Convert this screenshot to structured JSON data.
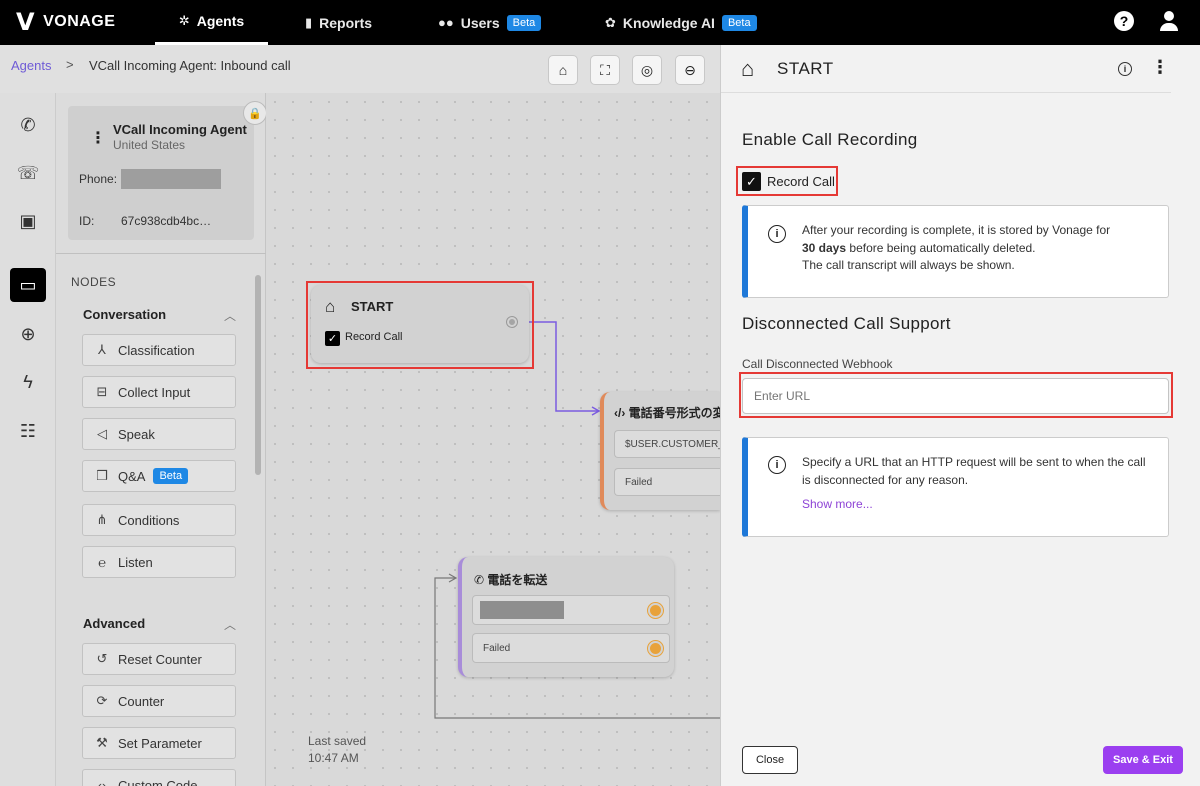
{
  "topbar": {
    "brand": "VONAGE",
    "nav": [
      {
        "label": "Agents",
        "icon": "agents-icon",
        "active": true
      },
      {
        "label": "Reports",
        "icon": "bar-chart-icon"
      },
      {
        "label": "Users",
        "icon": "users-icon",
        "badge": "Beta"
      },
      {
        "label": "Knowledge AI",
        "icon": "brain-icon",
        "badge": "Beta"
      }
    ],
    "help": "?"
  },
  "breadcrumb": {
    "root": "Agents",
    "separator": ">",
    "current": "VCall Incoming Agent: Inbound call"
  },
  "agent_card": {
    "name": "VCall Incoming Agent",
    "country": "United States",
    "phone_label": "Phone:",
    "id_label": "ID:",
    "id_value": "67c938cdb4bc…"
  },
  "nodes": {
    "title": "NODES",
    "sections": [
      {
        "title": "Conversation",
        "items": [
          {
            "label": "Classification",
            "icon": "classification-icon"
          },
          {
            "label": "Collect Input",
            "icon": "collect-input-icon"
          },
          {
            "label": "Speak",
            "icon": "speaker-icon"
          },
          {
            "label": "Q&A",
            "icon": "book-icon",
            "badge": "Beta"
          },
          {
            "label": "Conditions",
            "icon": "conditions-icon"
          },
          {
            "label": "Listen",
            "icon": "ear-icon"
          }
        ]
      },
      {
        "title": "Advanced",
        "items": [
          {
            "label": "Reset Counter",
            "icon": "reset-icon"
          },
          {
            "label": "Counter",
            "icon": "counter-icon"
          },
          {
            "label": "Set Parameter",
            "icon": "wrench-icon"
          },
          {
            "label": "Custom Code",
            "icon": "code-icon"
          }
        ]
      }
    ]
  },
  "canvas": {
    "start_node": {
      "title": "START",
      "checkbox_label": "Record Call"
    },
    "conversion_node": {
      "title": "電話番号形式の変",
      "row1": "$USER.CUSTOMER_",
      "row2": "Failed"
    },
    "transfer_node": {
      "title": "電話を転送",
      "row2": "Failed"
    },
    "last_saved_label": "Last saved",
    "last_saved_time": "10:47 AM"
  },
  "panel": {
    "title": "START",
    "recording_heading": "Enable Call Recording",
    "record_label": "Record Call",
    "record_checked": true,
    "recording_note_1": "After your recording is complete, it is stored by Vonage for",
    "recording_note_days": "30 days",
    "recording_note_2": "before being automatically deleted.",
    "recording_note_3": "The call transcript will always be shown.",
    "disconnect_heading": "Disconnected Call Support",
    "webhook_label": "Call Disconnected Webhook",
    "webhook_placeholder": "Enter URL",
    "webhook_value": "",
    "webhook_note": "Specify a URL that an HTTP request will be sent to when the call is disconnected for any reason.",
    "show_more": "Show more...",
    "close_label": "Close",
    "save_label": "Save & Exit"
  },
  "colors": {
    "accent_purple": "#9b3ff0",
    "info_blue": "#1e78d8",
    "beta_blue": "#1e88e5",
    "highlight_red": "#e53935"
  }
}
